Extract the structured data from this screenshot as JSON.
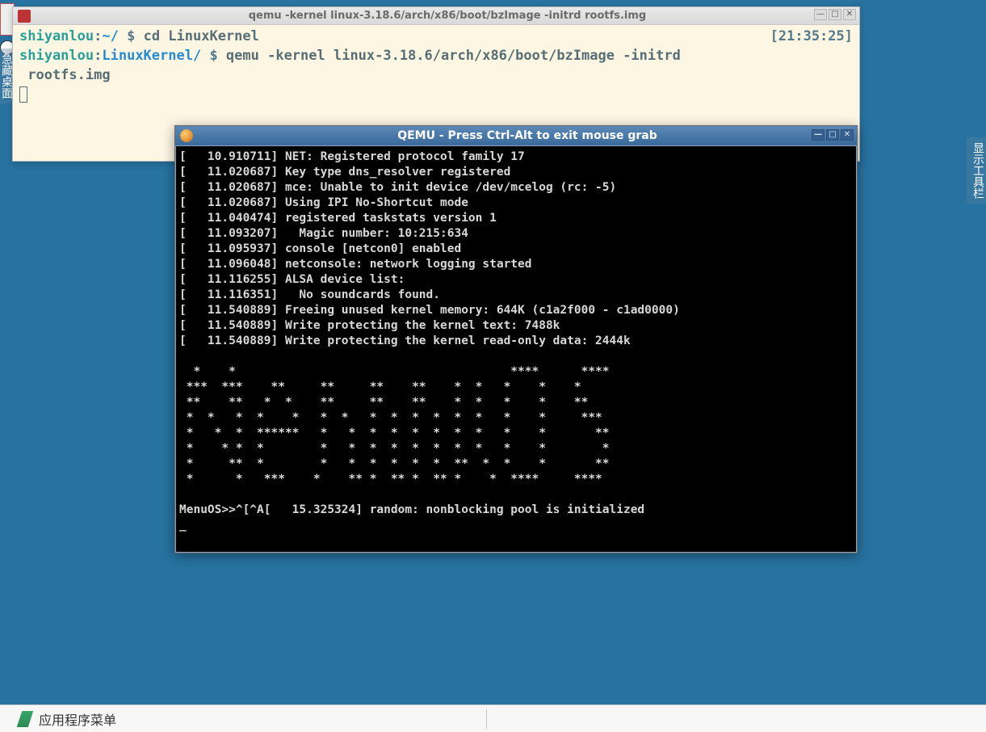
{
  "desktop": {
    "left_label": "急藏桌面",
    "right_label": "显示工具栏"
  },
  "terminal": {
    "title": "qemu -kernel linux-3.18.6/arch/x86/boot/bzImage -initrd rootfs.img",
    "timestamp": "[21:35:25]",
    "line1_user": "shiyanlou",
    "line1_sep": ":",
    "line1_path": "~/",
    "line1_sym": " $ ",
    "line1_cmd": "cd LinuxKernel",
    "line2_user": "shiyanlou",
    "line2_sep": ":",
    "line2_path": "LinuxKernel/",
    "line2_sym": " $ ",
    "line2_cmd": "qemu -kernel linux-3.18.6/arch/x86/boot/bzImage -initrd\n rootfs.img"
  },
  "qemu": {
    "title": "QEMU - Press Ctrl-Alt to exit mouse grab",
    "boot_log": "[   10.910711] NET: Registered protocol family 17\n[   11.020687] Key type dns_resolver registered\n[   11.020687] mce: Unable to init device /dev/mcelog (rc: -5)\n[   11.020687] Using IPI No-Shortcut mode\n[   11.040474] registered taskstats version 1\n[   11.093207]   Magic number: 10:215:634\n[   11.095937] console [netcon0] enabled\n[   11.096048] netconsole: network logging started\n[   11.116255] ALSA device list:\n[   11.116351]   No soundcards found.\n[   11.540889] Freeing unused kernel memory: 644K (c1a2f000 - c1ad0000)\n[   11.540889] Write protecting the kernel text: 7488k\n[   11.540889] Write protecting the kernel read-only data: 2444k\n\n  *    *                                       ****      ****\n ***  ***    **     **     **    **    *  *   *    *    *\n **    **   *  *    **     **    **    *  *   *    *    **\n *  *   *  *    *   *  *   *  *  *  *  *  *   *    *     ***\n *   *  *  ******   *   *  *  *  *  *  *  *   *    *       **\n *    * *  *        *   *  *  *  *  *  *  *   *    *        *\n *     **  *        *   *  *  *  *  *  **  *  *    *       **\n *      *   ***    *    ** *  ** *  ** *    *  ****     ****\n\nMenuOS>>^[^A[   15.325324] random: nonblocking pool is initialized\n_"
  },
  "panel": {
    "menu_label": "应用程序菜单"
  },
  "window_controls": {
    "min": "—",
    "max": "□",
    "close": "✕"
  }
}
